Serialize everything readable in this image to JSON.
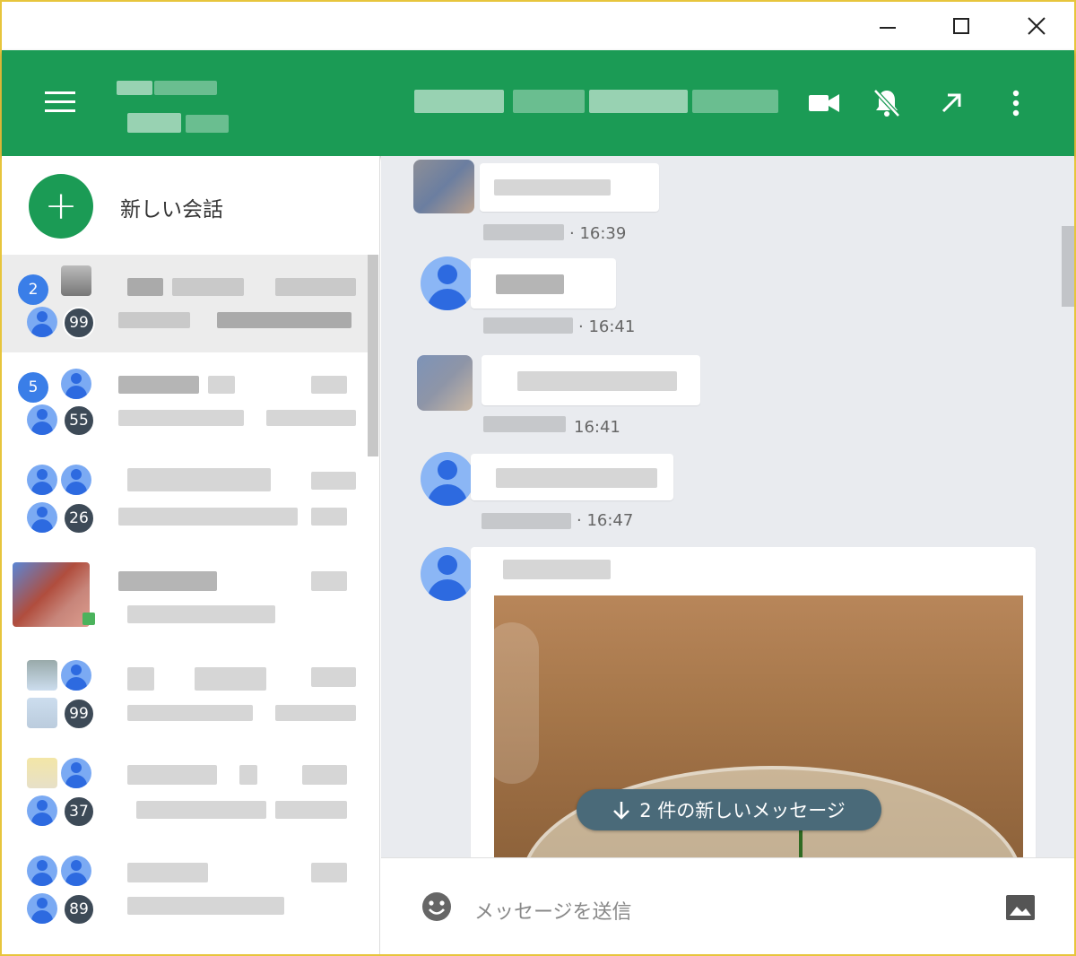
{
  "window": {
    "controls": {
      "minimize": "minimize-icon",
      "maximize": "maximize-icon",
      "close": "close-icon"
    }
  },
  "appbar": {
    "menu_icon": "hamburger-icon",
    "actions": [
      "video-call-icon",
      "notifications-off-icon",
      "open-external-icon",
      "more-vert-icon"
    ],
    "accent_color": "#1b9b55"
  },
  "sidebar": {
    "new_conversation_label": "新しい会話",
    "conversations": [
      {
        "unread": "2",
        "count": "99",
        "active": true
      },
      {
        "unread": "5",
        "count": "55",
        "active": false
      },
      {
        "unread": "",
        "count": "26",
        "active": false
      },
      {
        "unread": "",
        "count": "",
        "active": false
      },
      {
        "unread": "",
        "count": "99",
        "active": false
      },
      {
        "unread": "",
        "count": "37",
        "active": false
      },
      {
        "unread": "",
        "count": "89",
        "active": false
      }
    ]
  },
  "chat": {
    "messages": [
      {
        "time": "· 16:39"
      },
      {
        "time": "· 16:41"
      },
      {
        "time": "16:41"
      },
      {
        "time": "· 16:47"
      }
    ],
    "new_messages_pill": "2 件の新しいメッセージ"
  },
  "composer": {
    "placeholder": "メッセージを送信",
    "emoji_icon": "emoji-icon",
    "image_icon": "image-icon"
  }
}
